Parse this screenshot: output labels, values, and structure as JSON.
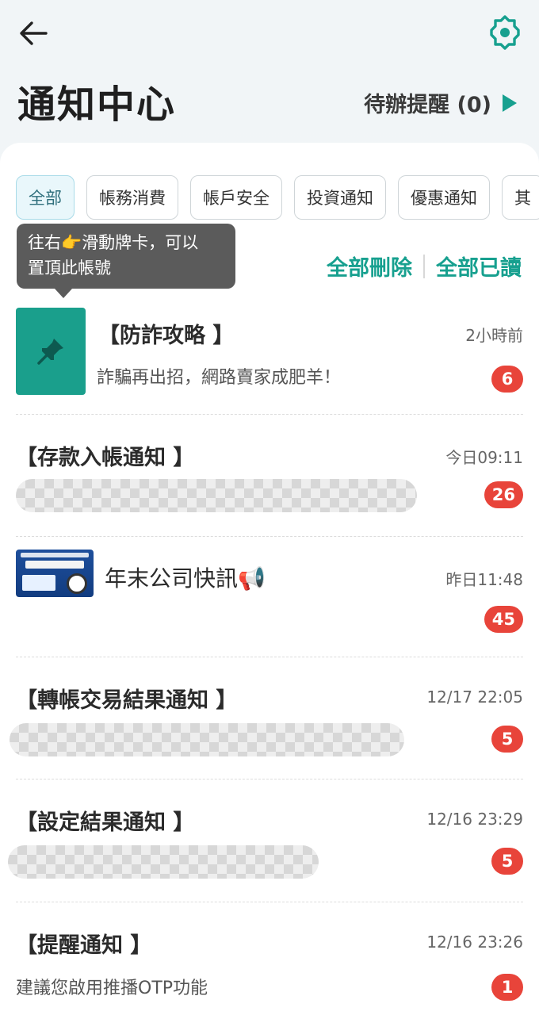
{
  "header": {
    "title": "通知中心",
    "todo_label": "待辦提醒 (0)"
  },
  "tabs": [
    "全部",
    "帳務消費",
    "帳戶安全",
    "投資通知",
    "優惠通知",
    "其"
  ],
  "tooltip": {
    "line1": "往右👉滑動牌卡，可以",
    "line2": "置頂此帳號"
  },
  "actions": {
    "delete_all": "全部刪除",
    "mark_all_read": "全部已讀"
  },
  "notifications": [
    {
      "title": "【防詐攻略 】",
      "time": "2小時前",
      "body": "詐騙再出招，網路賣家成肥羊！",
      "count": "6",
      "pinned_icon": "pin-icon"
    },
    {
      "title": "【存款入帳通知 】",
      "time": "今日09:11",
      "body": "",
      "count": "26",
      "redacted": true
    },
    {
      "title": "年末公司快訊📢",
      "time": "昨日11:48",
      "body": "",
      "count": "45",
      "thumbnail": "promo-thumbnail"
    },
    {
      "title": "【轉帳交易結果通知 】",
      "time": "12/17 22:05",
      "body": "",
      "count": "5",
      "redacted": true
    },
    {
      "title": "【設定結果通知 】",
      "time": "12/16 23:29",
      "body": "",
      "count": "5",
      "redacted": true
    },
    {
      "title": "【提醒通知 】",
      "time": "12/16 23:26",
      "body": "建議您啟用推播OTP功能",
      "count": "1"
    }
  ],
  "colors": {
    "accent": "#17a08f",
    "badge": "#e8443a",
    "active_chip_bg": "#e9f7fb"
  }
}
